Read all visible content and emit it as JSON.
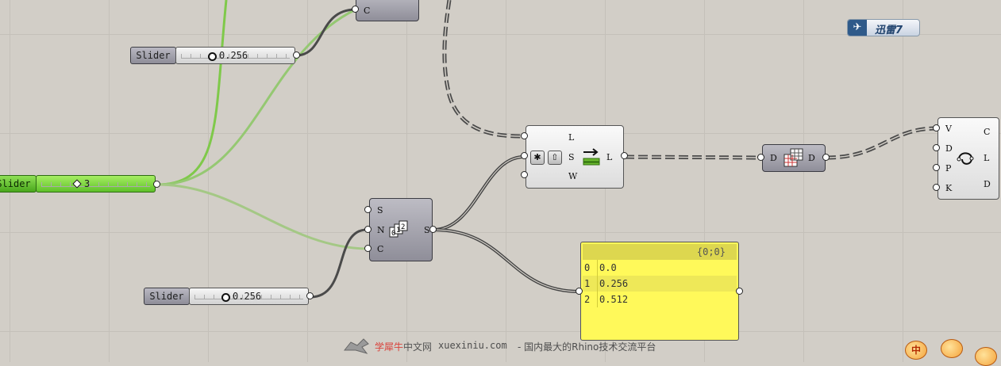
{
  "sliders": [
    {
      "label": "Slider",
      "value": "0.256"
    },
    {
      "label": "Slider",
      "value": "3"
    },
    {
      "label": "Slider",
      "value": "0.256"
    }
  ],
  "top_component": {
    "input": "C"
  },
  "series_component": {
    "inputs": [
      "S",
      "N",
      "C"
    ],
    "output": "S"
  },
  "list_component": {
    "inputs": [
      "L",
      "S",
      "W"
    ],
    "output": "L"
  },
  "data_component": {
    "input": "D",
    "output": "D"
  },
  "curve_component": {
    "inputs": [
      "V",
      "D",
      "P",
      "K"
    ],
    "outputs": [
      "C",
      "L",
      "D"
    ]
  },
  "panel": {
    "header": "{0;0}",
    "rows": [
      {
        "index": "0",
        "value": "0.0"
      },
      {
        "index": "1",
        "value": "0.256"
      },
      {
        "index": "2",
        "value": "0.512"
      }
    ]
  },
  "badge": {
    "text": "迅雷7"
  },
  "watermark": {
    "brand_red": "学犀牛",
    "brand_gray": "中文网",
    "url": "xuexiniu.com",
    "slogan": "- 国内最大的Rhino技术交流平台"
  },
  "emoticons": {
    "first": "中"
  },
  "colors": {
    "canvas": "#d2cec7",
    "panel": "#fff95a",
    "green_wire": "#7fc94a",
    "dark_wire": "#4a4a4a"
  }
}
